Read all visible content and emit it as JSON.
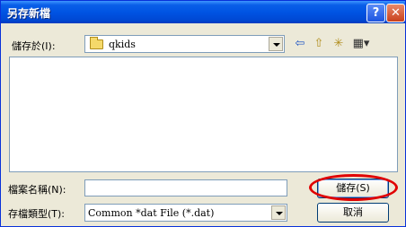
{
  "dialog": {
    "title": "另存新檔",
    "help_glyph": "?",
    "close_glyph": "✕"
  },
  "save_in": {
    "label": "儲存於(I):",
    "value": "qkids"
  },
  "toolbar": {
    "back_glyph": "⇦",
    "up_glyph": "⇧",
    "new_folder_glyph": "✳",
    "views_glyph": "▦▾"
  },
  "filename": {
    "label": "檔案名稱(N):",
    "value": ""
  },
  "filetype": {
    "label": "存檔類型(T):",
    "value": "Common *dat File (*.dat)"
  },
  "buttons": {
    "save": "儲存(S)",
    "cancel": "取消"
  },
  "colors": {
    "titlebar": "#0054e3",
    "dialog_bg": "#ece9d8",
    "highlight_oval": "#e00000"
  }
}
